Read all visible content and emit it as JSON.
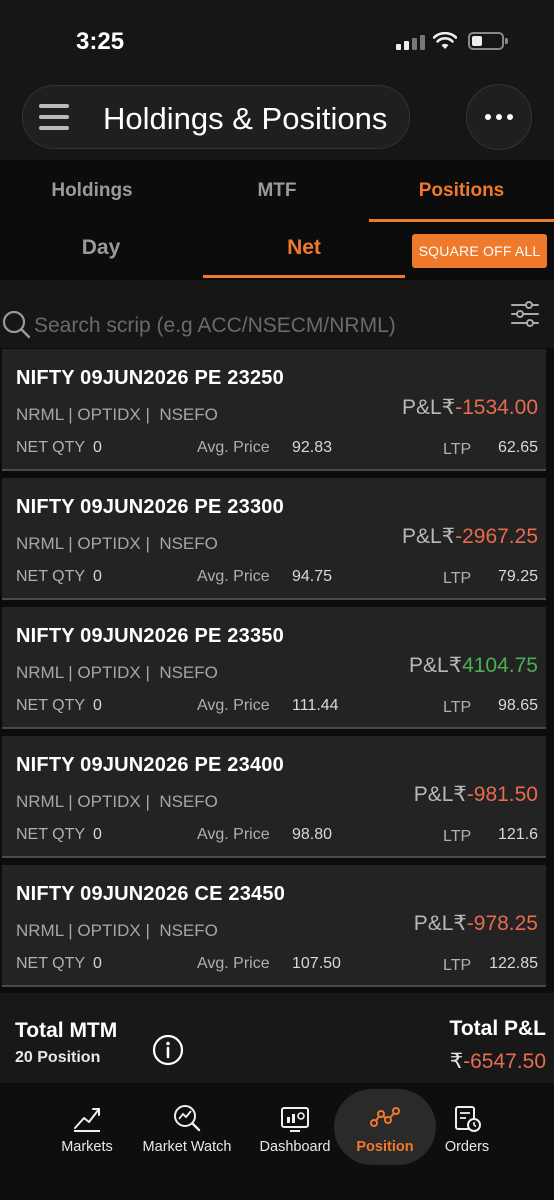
{
  "status_bar": {
    "time": "3:25"
  },
  "header": {
    "title": "Holdings & Positions"
  },
  "tabs": [
    {
      "label": "Holdings",
      "active": false
    },
    {
      "label": "MTF",
      "active": false
    },
    {
      "label": "Positions",
      "active": true
    }
  ],
  "subtabs": [
    {
      "label": "Day",
      "active": false
    },
    {
      "label": "Net",
      "active": true
    }
  ],
  "square_off_label": "SQUARE OFF ALL",
  "search": {
    "placeholder": "Search scrip (e.g ACC/NSECM/NRML)"
  },
  "labels": {
    "pl": "P&L",
    "rupee": "₹",
    "net_qty": "NET QTY",
    "avg_price": "Avg. Price",
    "ltp": "LTP"
  },
  "positions": [
    {
      "name": "NIFTY 09JUN2026 PE 23250",
      "product": "NRML",
      "instrument": "OPTIDX",
      "exchange": "NSEFO",
      "net_qty": "0",
      "avg_price": "92.83",
      "ltp": "62.65",
      "pl": "-1534.00",
      "pl_sign": "neg"
    },
    {
      "name": "NIFTY 09JUN2026 PE 23300",
      "product": "NRML",
      "instrument": "OPTIDX",
      "exchange": "NSEFO",
      "net_qty": "0",
      "avg_price": "94.75",
      "ltp": "79.25",
      "pl": "-2967.25",
      "pl_sign": "neg"
    },
    {
      "name": "NIFTY 09JUN2026 PE 23350",
      "product": "NRML",
      "instrument": "OPTIDX",
      "exchange": "NSEFO",
      "net_qty": "0",
      "avg_price": "111.44",
      "ltp": "98.65",
      "pl": "4104.75",
      "pl_sign": "pos"
    },
    {
      "name": "NIFTY 09JUN2026 PE 23400",
      "product": "NRML",
      "instrument": "OPTIDX",
      "exchange": "NSEFO",
      "net_qty": "0",
      "avg_price": "98.80",
      "ltp": "121.6",
      "pl": "-981.50",
      "pl_sign": "neg"
    },
    {
      "name": "NIFTY 09JUN2026 CE 23450",
      "product": "NRML",
      "instrument": "OPTIDX",
      "exchange": "NSEFO",
      "net_qty": "0",
      "avg_price": "107.50",
      "ltp": "122.85",
      "pl": "-978.25",
      "pl_sign": "neg"
    }
  ],
  "summary": {
    "mtm_title": "Total MTM",
    "position_count": "20 Position",
    "total_pl_title": "Total P&L",
    "total_pl_value": "-6547.50"
  },
  "bottom_nav": [
    {
      "label": "Markets",
      "icon": "chart-trend-icon",
      "active": false
    },
    {
      "label": "Market Watch",
      "icon": "market-watch-icon",
      "active": false
    },
    {
      "label": "Dashboard",
      "icon": "dashboard-icon",
      "active": false
    },
    {
      "label": "Position",
      "icon": "position-icon",
      "active": true
    },
    {
      "label": "Orders",
      "icon": "orders-icon",
      "active": false
    }
  ],
  "colors": {
    "accent": "#f07a2b",
    "loss": "#e86b4f",
    "profit": "#4caf50"
  }
}
